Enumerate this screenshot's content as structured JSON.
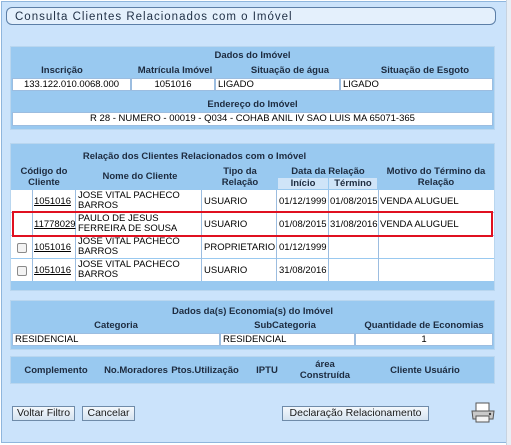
{
  "page_title": "Consulta Clientes Relacionados com o Imóvel",
  "dados_imovel": {
    "header": "Dados do Imóvel",
    "columns": [
      "Inscrição",
      "Matrícula Imóvel",
      "Situação de água",
      "Situação de Esgoto"
    ],
    "values": [
      "133.122.010.0068.000",
      "1051016",
      "LIGADO",
      "LIGADO"
    ],
    "endereco_label": "Endereço do Imóvel",
    "endereco": "R 28 - NUMERO - 00019 - Q034 - COHAB ANIL IV SAO LUIS MA 65071-365"
  },
  "clientes": {
    "header": "Relação dos Clientes Relacionados com o Imóvel",
    "col_codigo": "Código do Cliente",
    "col_nome": "Nome do Cliente",
    "col_tipo": "Tipo da Relação",
    "col_data": "Data da Relação",
    "col_inicio": "Início",
    "col_termino": "Término",
    "col_motivo": "Motivo do Término da Relação",
    "rows": [
      {
        "codigo": "1051016",
        "nome": "JOSE VITAL PACHECO BARROS",
        "tipo": "USUARIO",
        "inicio": "01/12/1999",
        "termino": "01/08/2015",
        "motivo": "VENDA ALUGUEL"
      },
      {
        "codigo": "11778029",
        "nome": "PAULO DE JESUS FERREIRA DE SOUSA",
        "tipo": "USUARIO",
        "inicio": "01/08/2015",
        "termino": "31/08/2016",
        "motivo": "VENDA ALUGUEL"
      },
      {
        "codigo": "1051016",
        "nome": "JOSE VITAL PACHECO BARROS",
        "tipo": "PROPRIETARIO",
        "inicio": "01/12/1999",
        "termino": "",
        "motivo": ""
      },
      {
        "codigo": "1051016",
        "nome": "JOSE VITAL PACHECO BARROS",
        "tipo": "USUARIO",
        "inicio": "31/08/2016",
        "termino": "",
        "motivo": ""
      }
    ]
  },
  "economias": {
    "header": "Dados da(s) Economia(s) do Imóvel",
    "col_categoria": "Categoria",
    "col_subcategoria": "SubCategoria",
    "col_quantidade": "Quantidade de Economias",
    "categoria": "RESIDENCIAL",
    "subcategoria": "RESIDENCIAL",
    "quantidade": "1"
  },
  "complemento": {
    "cols": [
      "Complemento",
      "No.Moradores",
      "Ptos.Utilização",
      "IPTU",
      "área Construída",
      "Cliente Usuário"
    ]
  },
  "buttons": {
    "voltar": "Voltar Filtro",
    "cancelar": "Cancelar",
    "declaracao": "Declaração Relacionamento"
  },
  "colors": {
    "panel": "#99c9f0",
    "background": "#cbe3fb",
    "highlight_border": "#e01020"
  }
}
